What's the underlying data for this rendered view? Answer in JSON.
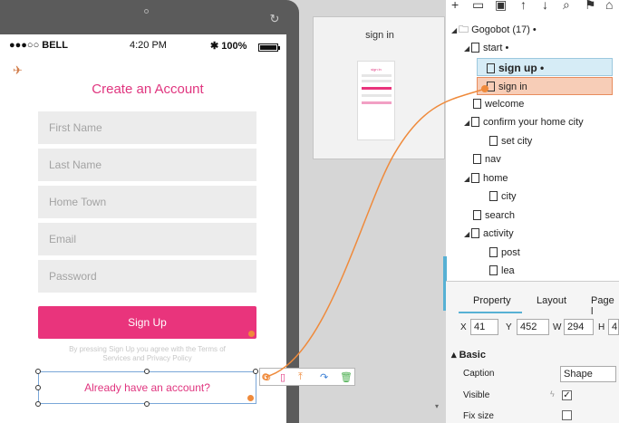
{
  "status_bar": {
    "carrier": "●●●○○ BELL",
    "wifi_icon": "wifi-icon",
    "time": "4:20 PM",
    "battery": "✱ 100%"
  },
  "form": {
    "title": "Create an Account",
    "fields": [
      {
        "placeholder": "First Name"
      },
      {
        "placeholder": "Last Name"
      },
      {
        "placeholder": "Home Town"
      },
      {
        "placeholder": "Email"
      },
      {
        "placeholder": "Password"
      }
    ],
    "signup_label": "Sign Up",
    "terms": "By pressing Sign Up you agree with the Terms of Services and Privacy Policy",
    "have_account": "Already have an account?"
  },
  "preview": {
    "title": "sign in",
    "thumb_title": "sign in"
  },
  "outline": {
    "root": "Gogobot (17) •",
    "items": [
      {
        "label": "start •",
        "level": 1,
        "expanded": true
      },
      {
        "label": "sign up •",
        "level": 2,
        "state": "selected"
      },
      {
        "label": "sign in",
        "level": 2,
        "state": "linked"
      },
      {
        "label": "welcome",
        "level": 1
      },
      {
        "label": "confirm your home city",
        "level": 1,
        "expanded": true
      },
      {
        "label": "set city",
        "level": 2
      },
      {
        "label": "nav",
        "level": 1
      },
      {
        "label": "home",
        "level": 1,
        "expanded": true
      },
      {
        "label": "city",
        "level": 2
      },
      {
        "label": "search",
        "level": 1
      },
      {
        "label": "activity",
        "level": 1,
        "expanded": true
      },
      {
        "label": "post",
        "level": 2
      },
      {
        "label": "lea",
        "level": 2
      }
    ]
  },
  "properties": {
    "tabs": [
      "Property",
      "Layout",
      "Page l"
    ],
    "x_label": "X",
    "x": "41",
    "y_label": "Y",
    "y": "452",
    "w_label": "W",
    "w": "294",
    "h_label": "H",
    "h": "4",
    "section": "Basic",
    "caption_label": "Caption",
    "caption_value": "Shape",
    "visible_label": "Visible",
    "visible": true,
    "fixsize_label": "Fix size",
    "fixsize": false
  },
  "colors": {
    "accent": "#e9347c",
    "link_line": "#ef8a3b",
    "selection": "#57b1d4"
  }
}
